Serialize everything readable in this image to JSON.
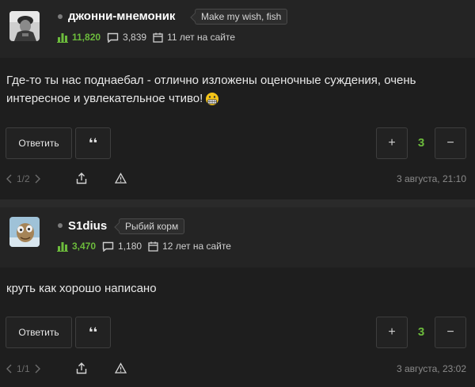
{
  "comments": [
    {
      "username": "джонни-мнемоник",
      "user_tag": "Make my wish, fish",
      "rating": "11,820",
      "comments_count": "3,839",
      "years_on_site": "11 лет на сайте",
      "text": "Где-то ты нас поднаебал - отлично изложены оценочные суждения, очень интересное и увлекательное чтиво!",
      "emoji": "grimacing-emoji",
      "reply_label": "Ответить",
      "quote_label": "❛❛",
      "plus_label": "+",
      "minus_label": "−",
      "votes": "3",
      "pager": "1/2",
      "timestamp": "3 августа, 21:10"
    },
    {
      "username": "S1dius",
      "user_tag": "Рыбий корм",
      "rating": "3,470",
      "comments_count": "1,180",
      "years_on_site": "12 лет на сайте",
      "text": "круть как хорошо написано",
      "reply_label": "Ответить",
      "quote_label": "❛❛",
      "plus_label": "+",
      "minus_label": "−",
      "votes": "3",
      "pager": "1/1",
      "timestamp": "3 августа, 23:02"
    }
  ],
  "colors": {
    "accent_green": "#6cbb3c",
    "background": "#1e1e1e",
    "header_bg": "#242424"
  }
}
